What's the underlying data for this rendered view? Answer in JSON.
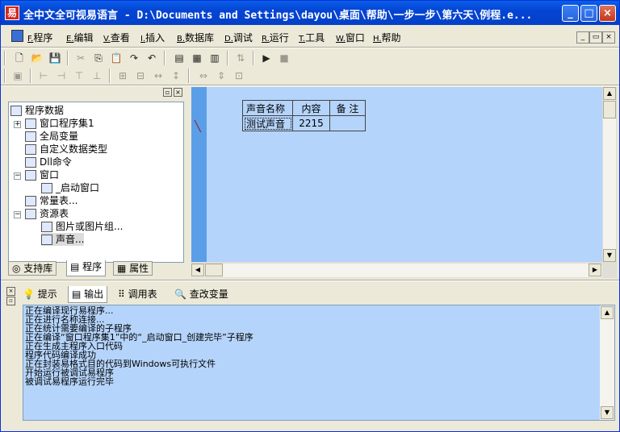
{
  "window": {
    "title": "全中文全可视易语言 - D:\\Documents and Settings\\dayou\\桌面\\帮助\\一步一步\\第六天\\例程.e...",
    "app_icon_glyph": "易",
    "minimize_glyph": "_",
    "maximize_glyph": "□",
    "close_glyph": "×"
  },
  "menu": [
    {
      "key": "F.",
      "label": "程序"
    },
    {
      "key": "E.",
      "label": "编辑"
    },
    {
      "key": "V.",
      "label": "查看"
    },
    {
      "key": "I.",
      "label": "插入"
    },
    {
      "key": "B.",
      "label": "数据库"
    },
    {
      "key": "D.",
      "label": "调试"
    },
    {
      "key": "R.",
      "label": "运行"
    },
    {
      "key": "T.",
      "label": "工具"
    },
    {
      "key": "W.",
      "label": "窗口"
    },
    {
      "key": "H.",
      "label": "帮助"
    }
  ],
  "mdi_buttons": [
    "_",
    "▭",
    "×"
  ],
  "left_pane": {
    "tree": [
      {
        "label": "程序数据",
        "icon": "program-data-icon"
      },
      {
        "label": "窗口程序集1",
        "icon": "assembly-icon"
      },
      {
        "label": "全局变量",
        "icon": "global-var-icon"
      },
      {
        "label": "自定义数据类型",
        "icon": "datatype-icon"
      },
      {
        "label": "Dll命令",
        "icon": "dll-icon"
      },
      {
        "label": "窗口",
        "icon": "window-icon"
      },
      {
        "label": "_启动窗口",
        "icon": "window-icon"
      },
      {
        "label": "常量表...",
        "icon": "const-icon"
      },
      {
        "label": "资源表",
        "icon": "resource-icon"
      },
      {
        "label": "图片或图片组...",
        "icon": "picture-icon"
      },
      {
        "label": "声音...",
        "icon": "sound-icon"
      }
    ],
    "tabs": [
      "支持库",
      "程序",
      "属性"
    ]
  },
  "sound_table": {
    "headers": [
      "声音名称",
      "内容",
      "备 注"
    ],
    "rows": [
      [
        "测试声音",
        "2215",
        ""
      ]
    ]
  },
  "bottom_panel": {
    "tabs": [
      "提示",
      "输出",
      "调用表",
      "查改变量"
    ],
    "output_lines": [
      "正在编译现行易程序...",
      "正在进行名称连接...",
      "正在统计需要编译的子程序",
      "正在编译“窗口程序集1”中的“_启动窗口_创建完毕”子程序",
      "正在生成主程序入口代码",
      "程序代码编译成功",
      "正在封装易格式目的代码到Windows可执行文件",
      "开始运行被调试易程序",
      "被调试易程序运行完毕"
    ]
  },
  "colors": {
    "title_bar": "#0545d4",
    "editor_bg": "#b5d4fb",
    "gutter": "#5b9ee8"
  }
}
